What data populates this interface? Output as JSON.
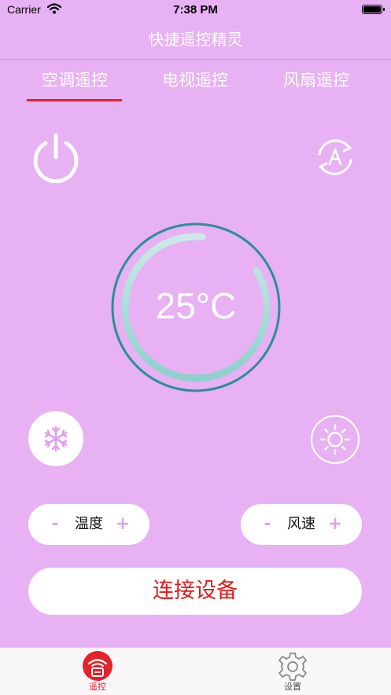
{
  "status_bar": {
    "carrier": "Carrier",
    "time": "7:38 PM"
  },
  "header": {
    "title": "快捷遥控精灵"
  },
  "tabs": [
    {
      "label": "空调遥控",
      "active": true
    },
    {
      "label": "电视遥控",
      "active": false
    },
    {
      "label": "风扇遥控",
      "active": false
    }
  ],
  "remote": {
    "temperature": "25°C",
    "temp_level": 0.85,
    "temp_control": {
      "minus": "-",
      "label": "温度",
      "plus": "+"
    },
    "fan_control": {
      "minus": "-",
      "label": "风速",
      "plus": "+"
    },
    "connect_label": "连接设备",
    "icons": {
      "power": "power-icon",
      "auto_mode": "auto-mode-icon",
      "cool": "snowflake-icon",
      "heat": "sun-icon"
    }
  },
  "tab_bar": {
    "items": [
      {
        "label": "遥控",
        "icon": "remote-icon",
        "active": true
      },
      {
        "label": "设置",
        "icon": "gear-icon",
        "active": false
      }
    ]
  },
  "colors": {
    "background": "#e7b1f3",
    "accent": "#e3222a",
    "dial_ring": "#2a8f96",
    "dial_arc": "#a6dcd9"
  }
}
